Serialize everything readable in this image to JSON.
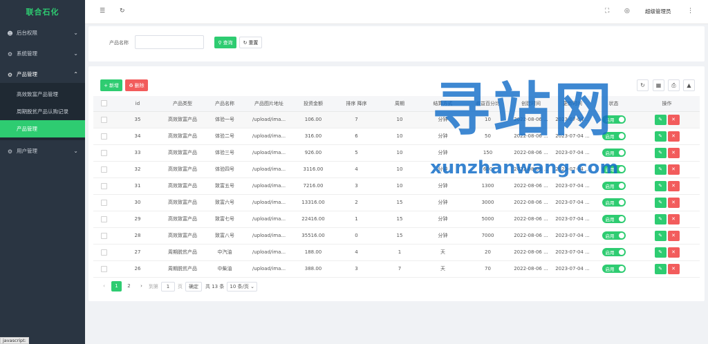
{
  "brand": "联合石化",
  "sidebar": {
    "items": [
      {
        "label": "后台权限",
        "icon": "user-icon"
      },
      {
        "label": "系统管理",
        "icon": "gear-icon"
      },
      {
        "label": "产品管理",
        "icon": "gear-icon"
      },
      {
        "label": "用户管理",
        "icon": "gear-icon"
      }
    ],
    "submenu": [
      "高效致富产品管理",
      "周期脱贫产品认购记录",
      "产品管理"
    ],
    "active_sub": "产品管理"
  },
  "header": {
    "admin": "超级管理员"
  },
  "search": {
    "label": "产品名称",
    "placeholder": "",
    "query_label": "查询",
    "reset_label": "重置"
  },
  "toolbar": {
    "add_label": "新增",
    "delete_label": "删除"
  },
  "table": {
    "columns": [
      "id",
      "产品类型",
      "产品名称",
      "产品图片地址",
      "投资金额",
      "排序 降序",
      "周期",
      "结算方式",
      "收益百分比",
      "创建时间",
      "更新时间",
      "状态",
      "操作"
    ],
    "rows": [
      [
        "35",
        "高效致富产品",
        "体验一号",
        "/upload/ima...",
        "106.00",
        "7",
        "10",
        "分钟",
        "10",
        "2022-08-06 ...",
        "2023-07-04 ...",
        "启用"
      ],
      [
        "34",
        "高效致富产品",
        "体验二号",
        "/upload/ima...",
        "316.00",
        "6",
        "10",
        "分钟",
        "50",
        "2022-08-06 ...",
        "2023-07-04 ...",
        "启用"
      ],
      [
        "33",
        "高效致富产品",
        "体验三号",
        "/upload/ima...",
        "926.00",
        "5",
        "10",
        "分钟",
        "150",
        "2022-08-06 ...",
        "2023-07-04 ...",
        "启用"
      ],
      [
        "32",
        "高效致富产品",
        "体验四号",
        "/upload/ima...",
        "3116.00",
        "4",
        "10",
        "分钟",
        "600",
        "2022-08-06 ...",
        "2023-07-04 ...",
        "启用"
      ],
      [
        "31",
        "高效致富产品",
        "致富五号",
        "/upload/ima...",
        "7216.00",
        "3",
        "10",
        "分钟",
        "1300",
        "2022-08-06 ...",
        "2023-07-04 ...",
        "启用"
      ],
      [
        "30",
        "高效致富产品",
        "致富六号",
        "/upload/ima...",
        "13316.00",
        "2",
        "15",
        "分钟",
        "3000",
        "2022-08-06 ...",
        "2023-07-04 ...",
        "启用"
      ],
      [
        "29",
        "高效致富产品",
        "致富七号",
        "/upload/ima...",
        "22416.00",
        "1",
        "15",
        "分钟",
        "5000",
        "2022-08-06 ...",
        "2023-07-04 ...",
        "启用"
      ],
      [
        "28",
        "高效致富产品",
        "致富八号",
        "/upload/ima...",
        "35516.00",
        "0",
        "15",
        "分钟",
        "7000",
        "2022-08-06 ...",
        "2023-07-04 ...",
        "启用"
      ],
      [
        "27",
        "周期脱贫产品",
        "中汽油",
        "/upload/ima...",
        "188.00",
        "4",
        "1",
        "天",
        "20",
        "2022-08-06 ...",
        "2023-07-04 ...",
        "启用"
      ],
      [
        "26",
        "周期脱贫产品",
        "中柴油",
        "/upload/ima...",
        "388.00",
        "3",
        "7",
        "天",
        "70",
        "2022-08-06 ...",
        "2023-07-04 ...",
        "启用"
      ]
    ]
  },
  "pager": {
    "pages": [
      "1",
      "2"
    ],
    "goto_label": "到第",
    "goto_value": "1",
    "page_unit": "页",
    "confirm_label": "确定",
    "total_label": "共 13 条",
    "size_label": "10 条/页"
  },
  "watermark": {
    "cn": "寻站网",
    "en": "xunzhanwang.com"
  },
  "status_tip": "javascript:",
  "colors": {
    "accent": "#2ecc71",
    "danger": "#f25c5c",
    "sidebar": "#2a3542",
    "watermark": "#146ec8"
  }
}
